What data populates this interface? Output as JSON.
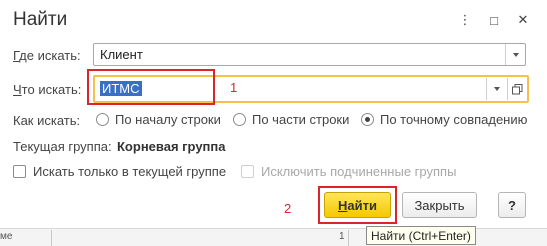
{
  "dialog": {
    "title": "Найти",
    "controls": {
      "more": "⋮",
      "maximize": "□",
      "close": "✕"
    }
  },
  "where": {
    "label_accel": "Г",
    "label_rest": "де искать:",
    "value": "Клиент"
  },
  "what": {
    "label_accel": "Ч",
    "label_rest": "то искать:",
    "value": "ИТМС"
  },
  "how": {
    "label": "Как искать:",
    "options": [
      "По началу строки",
      "По части строки",
      "По точному совпадению"
    ],
    "selected_index": 2
  },
  "group": {
    "label": "Текущая группа:",
    "value": "Корневая группа"
  },
  "checkboxes": {
    "only_current": "Искать только в текущей группе",
    "exclude_sub": "Исключить подчиненные группы"
  },
  "buttons": {
    "find_accel": "Н",
    "find_rest": "айти",
    "close": "Закрыть",
    "help": "?"
  },
  "annotations": {
    "one": "1",
    "two": "2"
  },
  "tooltip": "Найти (Ctrl+Enter)",
  "background": {
    "fragment": "ме",
    "fragment2": "1"
  },
  "colors": {
    "accent": "#f5c800",
    "highlight_border": "#f5c14a",
    "annotation": "#d8262a"
  }
}
